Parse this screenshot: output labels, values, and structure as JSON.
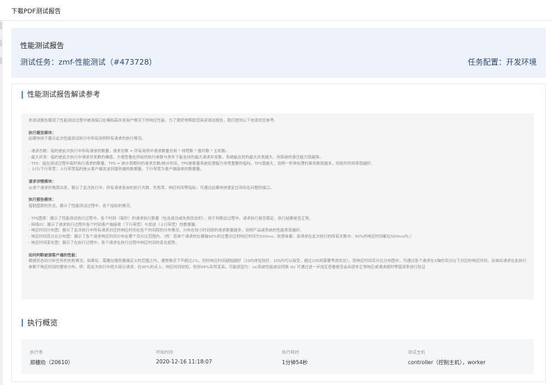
{
  "window": {
    "title": "下载PDF测试报告"
  },
  "header": {
    "title": "性能测试报告",
    "task": "测试任务：zmf-性能测试（#473728）",
    "config": "任务配置：开发环境"
  },
  "guide": {
    "title": "性能测试报告解读参考",
    "intro": "本测试报告展现了性能测试过程中被测接口在模拟高并发用户情况下的响应性能，为了更好地帮助您阅读测试报告，我们提供以下信息供您参考。",
    "sections": [
      {
        "heading": "执行概览模块：",
        "desc": "此模块用于展示此次性能测试执行中所有用例所有请求的执行情况。",
        "items": [
          "- 请求总数：指的是此次执行中所有请求的数量，请求总数 = 所有用例中请求数量总和 * 线程数 * 循环数 * 主机数。",
          "- 最大并发：指的是此次执行中请求并发数的峰值，方便查看在所给的执行参数与条件下能支持的最大请求并发数，系统能达到的最大并发越大，则系统的承压能力就越强。",
          "- TPS：指在测试过程中每秒执行请求的数量，TPS = 统计周期内的请求总数/统计时间，TPS是衡量系统处理能力非常重要的指标，TPS值越大，说明一秒钟处理的事务数就越多，则软件的效率就越好。",
          "- 上行/下行带宽：上行带宽指的是从客户端发送到服务端的数据量，下行带宽为客户端接收的数据量。"
        ]
      },
      {
        "heading": "请求详情模块：",
        "desc": "从单个请求的角度出发，展示了此次执行中，所有请求各自的执行次数、失败率、响应时间等指标；可通过此模块快速定位到存在问题的接口。",
        "items": []
      },
      {
        "heading": "执行报告模块：",
        "desc": "借助图表的形式，展示了性能测试过程中，各个指标的情况。",
        "items": [
          "- TPS图表：展示了性能测试执行过程中，各个时刻（每秒）的请求执行数量（包含成功或失败状态的），用于判断此过程中，请求执行是否稳定，执行结果是否正常。",
          "- 网络IO：展示了请求执行过程中各个时刻客户端接收（下行带宽）与发送（上行带宽）的数据量。",
          "- 响应时间分布图：展示了此次执行中所有请求对应的响应时间在各个时间段的分布情况，分布在较小时间段的请求数量越多，说明产品或系统的性能表现越好。",
          "- 响应时间百分比分布图：展示了各个请求响应时间分布在哪个百分比范围内。（例：若单个请求的在横轴90%的位置对应的响应时间为500ms，则意味着：该请求在此次执行的所有次数中，90%的响应时间都在500ms内。）",
          "- 响应时间变化图：展示了在执行过程中，各个请求在执行过程中响应时间的变化趋势。"
        ]
      },
      {
        "heading": "如何判断被测客户端的性能：",
        "desc": "根据状态码分析任务的失败情况，如果有，需要在服务器端定义的范围之内，通常情况下不超过1%，同时响应时间越短越好（2S内体验较好，10S内可以接受，超过10S则需要考虑优化）。而响应时间百分比分布图中，可通过各个请求在X轴的百分比下对应的响应时间，反映出请求在此执行参数下响应时间的整体分布。例：若此次执行中绝大部分请求，在90%的点上，响应时间较短，但到99%突然变高，可能原因为：(a)系统性能波动而致 (b) 可通过进一步加压查看是否会出现非正常响应或请求超时等错误来进行验证",
        "items": []
      }
    ]
  },
  "overview": {
    "title": "执行概览",
    "fields": [
      {
        "label": "执行者",
        "value": "郑穗劝（20610）"
      },
      {
        "label": "开始时间",
        "value": "2020-12-16 11:18:07"
      },
      {
        "label": "执行耗时",
        "value": "1分钟54秒"
      },
      {
        "label": "测试主机",
        "value": "controller（控制主机），worker"
      }
    ]
  }
}
